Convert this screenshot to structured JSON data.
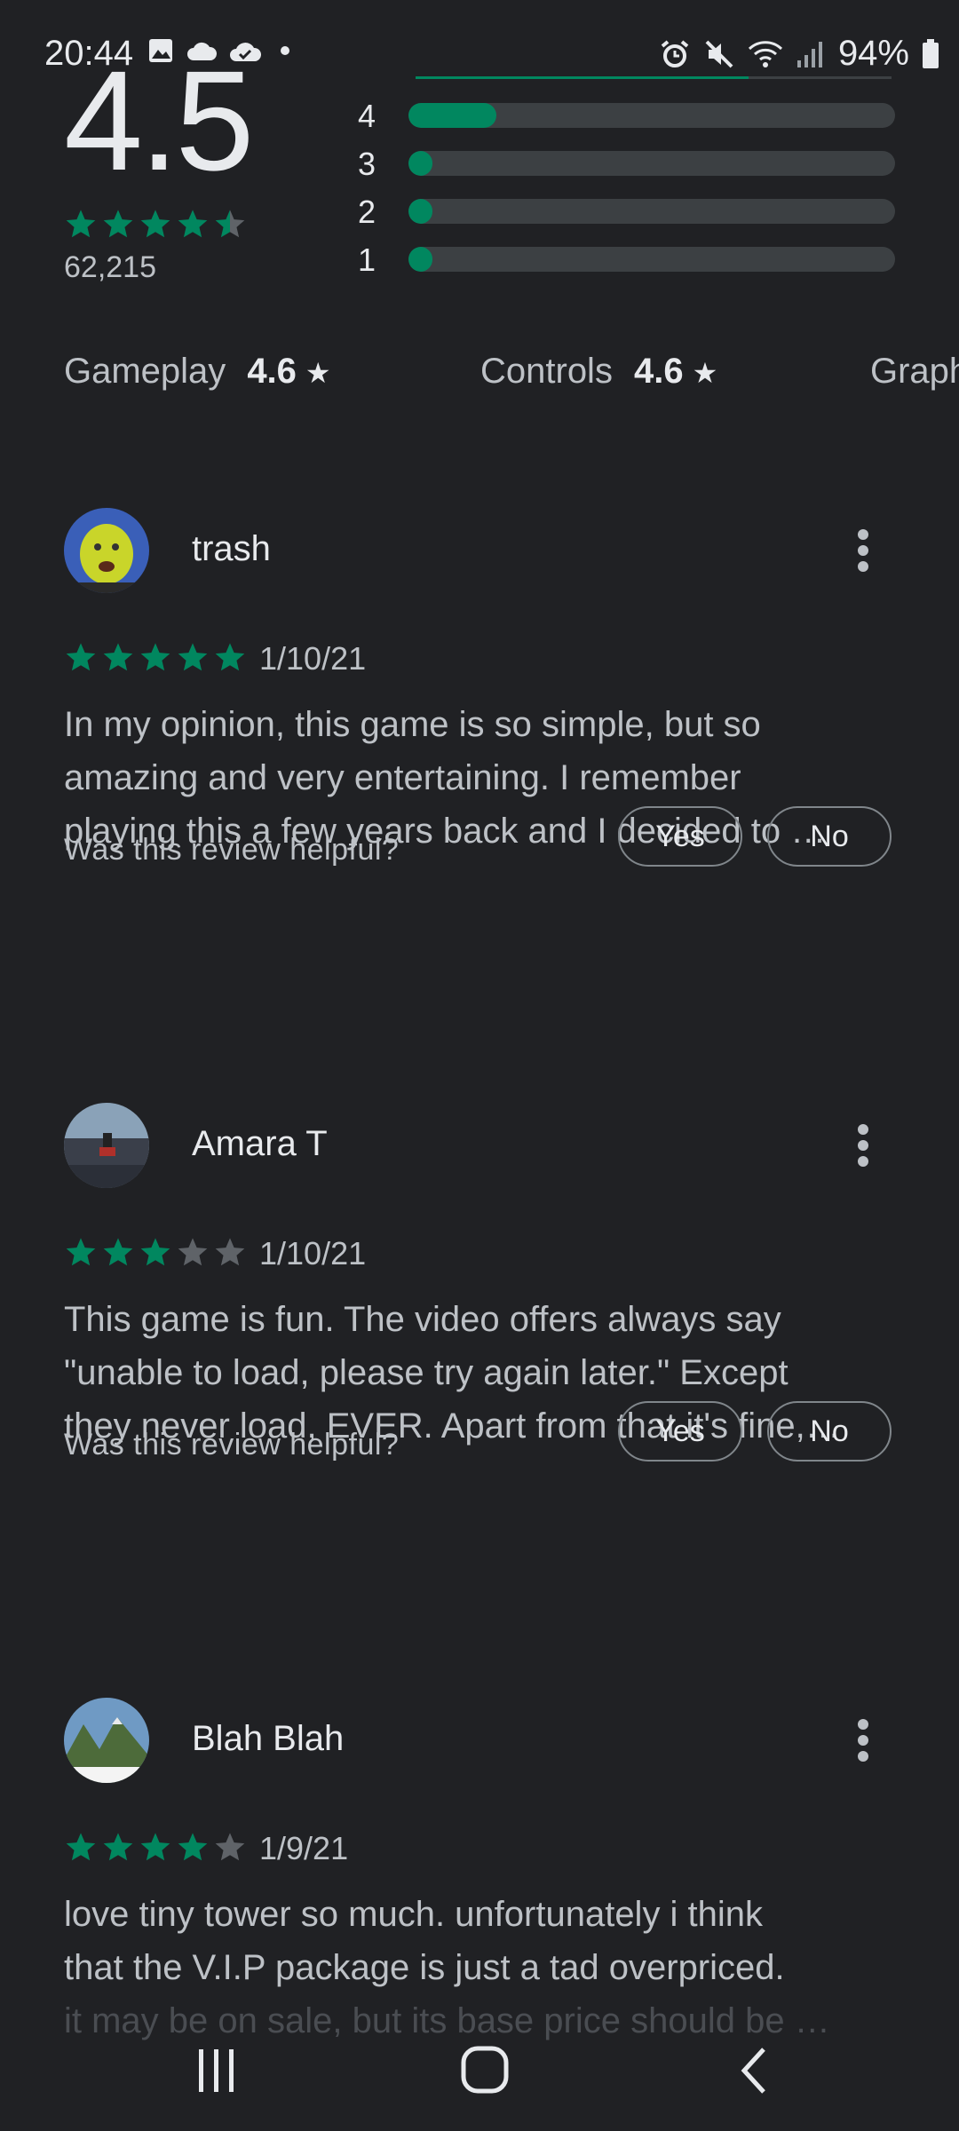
{
  "status_bar": {
    "time": "20:44",
    "battery": "94%",
    "left_icons": [
      "image-icon",
      "cloud-icon",
      "cloud-check-icon",
      "dot-icon"
    ],
    "right_icons": [
      "alarm-icon",
      "mute-icon",
      "wifi-icon",
      "signal-icon",
      "battery-icon"
    ]
  },
  "rating_summary": {
    "average": "4.5",
    "count": "62,215",
    "stars": 4.5,
    "distribution": [
      {
        "label": "4",
        "fraction": 0.18
      },
      {
        "label": "3",
        "fraction": 0.03
      },
      {
        "label": "2",
        "fraction": 0.03
      },
      {
        "label": "1",
        "fraction": 0.03
      }
    ],
    "top_bar_fraction": 0.7
  },
  "categories": [
    {
      "name": "Gameplay",
      "score": "4.6",
      "star": "★"
    },
    {
      "name": "Controls",
      "score": "4.6",
      "star": "★"
    },
    {
      "name": "Graphics",
      "score": "",
      "star": ""
    }
  ],
  "helpful_prompt": "Was this review helpful?",
  "yes_label": "Yes",
  "no_label": "No",
  "reviews": [
    {
      "name": "trash",
      "stars": 5,
      "date": "1/10/21",
      "lines": [
        "In my opinion, this game is so simple, but so",
        "amazing and very entertaining. I remember",
        "playing this a few years back and I decided to …"
      ]
    },
    {
      "name": "Amara T",
      "stars": 3,
      "date": "1/10/21",
      "lines": [
        "This game is fun. The video offers always say",
        "\"unable to load, please try again later.\" Except",
        "they never load, EVER. Apart from that it's fine,…"
      ]
    },
    {
      "name": "Blah Blah",
      "stars": 4,
      "date": "1/9/21",
      "lines": [
        "love tiny tower so much. unfortunately i think",
        "that the V.I.P package is just a tad overpriced.",
        "it may be on sale, but its base price should be …"
      ]
    }
  ],
  "colors": {
    "background": "#202124",
    "accent_green": "#01875f",
    "track": "#3c4043",
    "text_primary": "#e8eaed",
    "text_secondary": "#bdc1c6"
  },
  "nav": {
    "recents_icon": "recents-icon",
    "home_icon": "home-icon",
    "back_icon": "back-icon"
  }
}
